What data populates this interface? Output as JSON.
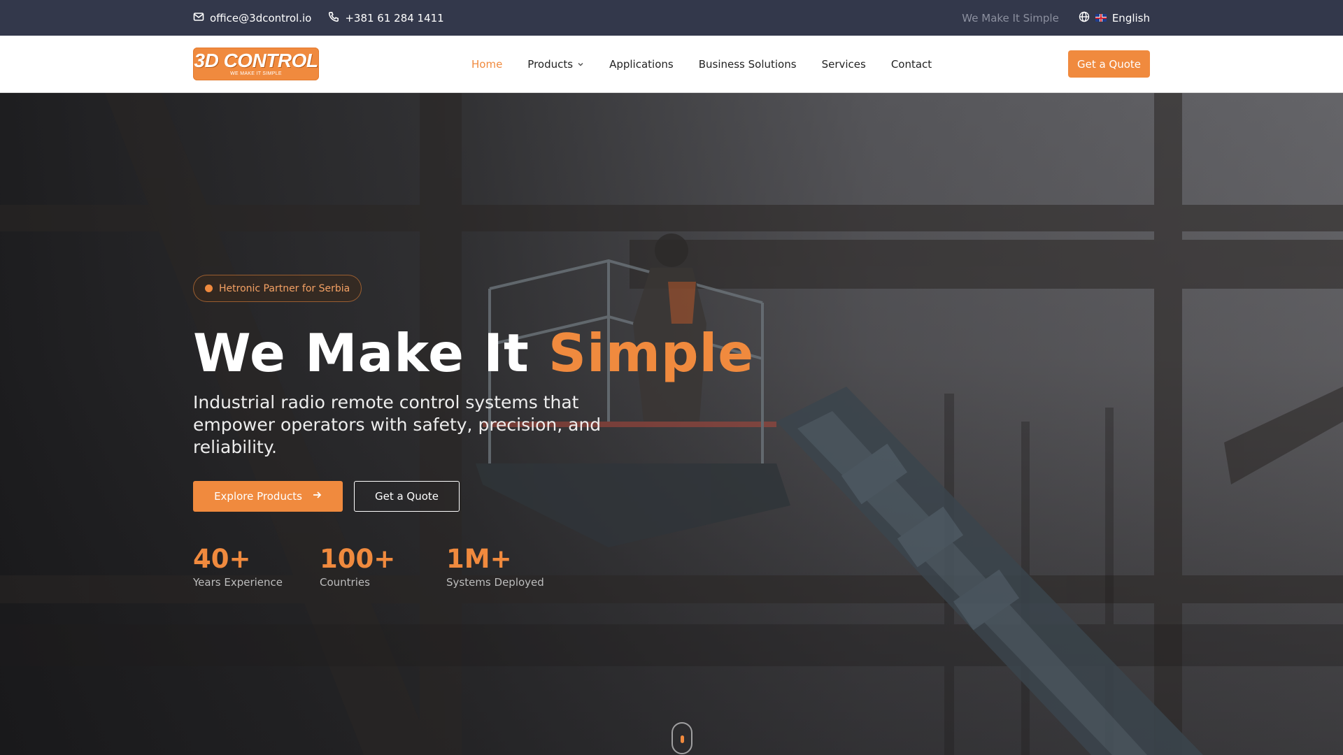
{
  "topbar": {
    "email": "office@3dcontrol.io",
    "phone": "+381 61 284 1411",
    "tagline": "We Make It Simple",
    "language": "English",
    "icons": [
      "mail-icon",
      "phone-icon",
      "globe-icon",
      "uk-flag-icon"
    ]
  },
  "nav": {
    "logo_text": "3D CONTROL",
    "logo_subtext": "WE MAKE IT SIMPLE",
    "items": [
      {
        "label": "Home",
        "active": true
      },
      {
        "label": "Products",
        "has_dropdown": true
      },
      {
        "label": "Applications"
      },
      {
        "label": "Business Solutions"
      },
      {
        "label": "Services"
      },
      {
        "label": "Contact"
      }
    ],
    "cta_label": "Get a Quote"
  },
  "hero": {
    "badge": "Hetronic Partner for Serbia",
    "headline_part1": "We Make It",
    "headline_accent": "Simple",
    "subtext": "Industrial radio remote control systems that empower operators with safety, precision, and reliability.",
    "primary_button": "Explore Products",
    "secondary_button": "Get a Quote",
    "stats": [
      {
        "value": "40+",
        "label": "Years Experience"
      },
      {
        "value": "100+",
        "label": "Countries"
      },
      {
        "value": "1M+",
        "label": "Systems Deployed"
      }
    ]
  },
  "colors": {
    "accent": "#f08a3e",
    "topbar_bg": "#33384b",
    "nav_bg": "#ffffff"
  }
}
